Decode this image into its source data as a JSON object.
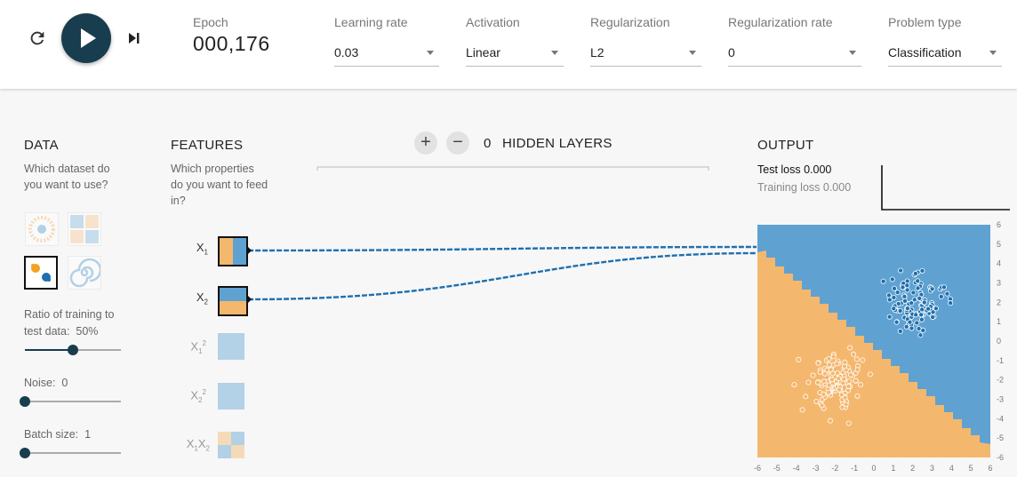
{
  "controls": {
    "epoch_label": "Epoch",
    "epoch_value": "000,176",
    "learning_rate": {
      "label": "Learning rate",
      "value": "0.03"
    },
    "activation": {
      "label": "Activation",
      "value": "Linear"
    },
    "regularization": {
      "label": "Regularization",
      "value": "L2"
    },
    "regularization_rate": {
      "label": "Regularization rate",
      "value": "0"
    },
    "problem_type": {
      "label": "Problem type",
      "value": "Classification"
    },
    "icons": {
      "reset": "reset-icon",
      "play": "play-icon",
      "step": "step-forward-icon"
    }
  },
  "data_panel": {
    "title": "DATA",
    "description": "Which dataset do you want to use?",
    "datasets": [
      {
        "name": "circle",
        "selected": false
      },
      {
        "name": "xor",
        "selected": false
      },
      {
        "name": "gaussian",
        "selected": true
      },
      {
        "name": "spiral",
        "selected": false
      }
    ],
    "ratio_label": "Ratio of training to test data:",
    "ratio_value": "50%",
    "noise_label": "Noise:",
    "noise_value": "0",
    "batch_label": "Batch size:",
    "batch_value": "1",
    "ratio_level": 0.5,
    "noise_level": 0,
    "batch_level": 0
  },
  "features_panel": {
    "title": "FEATURES",
    "description": "Which properties do you want to feed in?",
    "features": [
      {
        "base": "X",
        "sub": "1",
        "sup": "",
        "active": true
      },
      {
        "base": "X",
        "sub": "2",
        "sup": "",
        "active": true
      },
      {
        "base": "X",
        "sub": "1",
        "sup": "2",
        "active": false
      },
      {
        "base": "X",
        "sub": "2",
        "sup": "2",
        "active": false
      },
      {
        "base": "X",
        "sub": "1",
        "sup": "",
        "base2": "X",
        "sub2": "2",
        "active": false
      }
    ]
  },
  "hidden_layers": {
    "count": "0",
    "label": "HIDDEN LAYERS",
    "add_label": "+",
    "remove_label": "−"
  },
  "output_panel": {
    "title": "OUTPUT",
    "test_loss": "Test loss 0.000",
    "training_loss": "Training loss 0.000",
    "x_ticks": [
      "-6",
      "-5",
      "-4",
      "-3",
      "-2",
      "-1",
      "0",
      "1",
      "2",
      "3",
      "4",
      "5",
      "6"
    ],
    "y_ticks": [
      "6",
      "5",
      "4",
      "3",
      "2",
      "1",
      "0",
      "-1",
      "-2",
      "-3",
      "-4",
      "-5",
      "-6"
    ]
  },
  "colors": {
    "blue": "#5fa2d2",
    "orange": "#f4b76e",
    "dark_blue": "#1f6fae",
    "dark": "#183d4e"
  }
}
